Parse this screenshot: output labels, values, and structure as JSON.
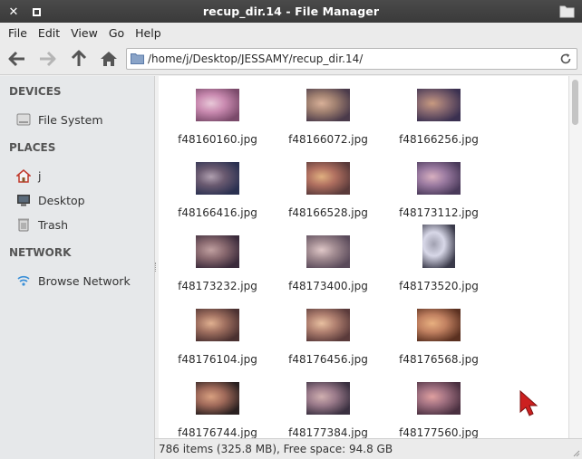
{
  "window": {
    "title": "recup_dir.14 - File Manager",
    "close_glyph": "✕",
    "accent": "#3d3d3d"
  },
  "menu": [
    "File",
    "Edit",
    "View",
    "Go",
    "Help"
  ],
  "toolbar": {
    "icons": [
      "back-arrow-icon",
      "forward-arrow-icon",
      "up-arrow-icon",
      "home-icon"
    ],
    "location": "/home/j/Desktop/JESSAMY/recup_dir.14/"
  },
  "sidebar": {
    "devices_heading": "DEVICES",
    "devices": [
      {
        "label": "File System",
        "icon": "drive-icon"
      }
    ],
    "places_heading": "PLACES",
    "places": [
      {
        "label": "j",
        "icon": "home-icon"
      },
      {
        "label": "Desktop",
        "icon": "desktop-icon"
      },
      {
        "label": "Trash",
        "icon": "trash-icon"
      }
    ],
    "network_heading": "NETWORK",
    "network": [
      {
        "label": "Browse Network",
        "icon": "network-icon"
      }
    ]
  },
  "files": [
    "f48160160.jpg",
    "f48166072.jpg",
    "f48166256.jpg",
    "f48166416.jpg",
    "f48166528.jpg",
    "f48173112.jpg",
    "f48173232.jpg",
    "f48173400.jpg",
    "f48173520.jpg",
    "f48176104.jpg",
    "f48176456.jpg",
    "f48176568.jpg",
    "f48176744.jpg",
    "f48177384.jpg",
    "f48177560.jpg"
  ],
  "status": {
    "text": "786 items (325.8 MB), Free space: 94.8 GB"
  }
}
